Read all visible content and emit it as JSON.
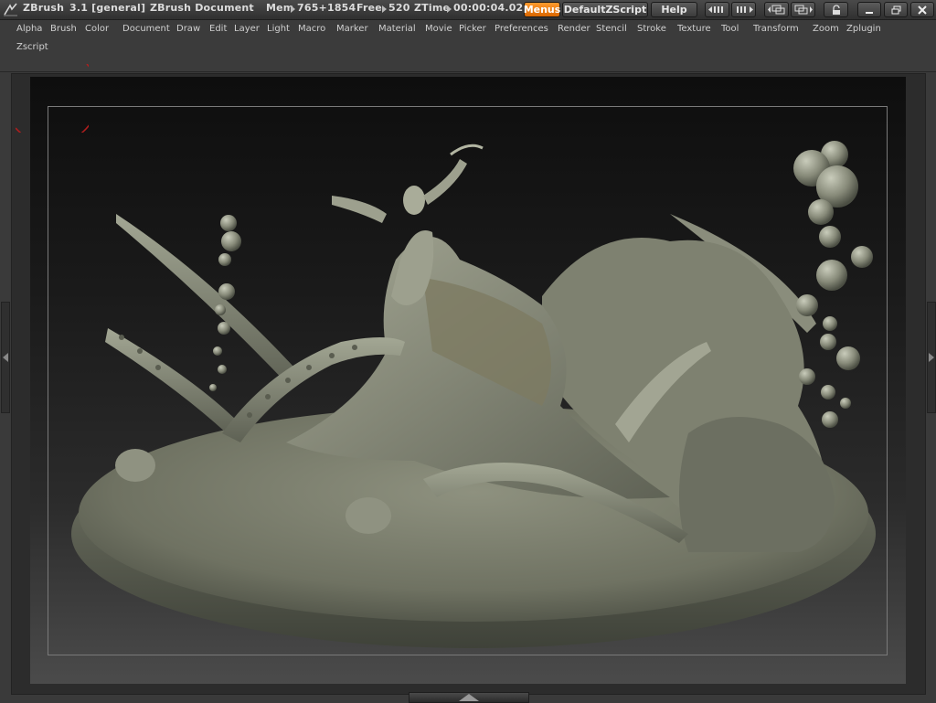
{
  "titlebar": {
    "app_name": "ZBrush",
    "version": "3.1 [general]",
    "document_name": "ZBrush Document",
    "mem_label": "Mem",
    "mem_value": "765+1854",
    "free_label": "Free",
    "free_value": "520",
    "ztime_label": "ZTime",
    "ztime_value": "00:00:04.02",
    "menus_button": "Menus",
    "script_button": "DefaultZScript",
    "help_button": "Help",
    "accent_color": "#f07a10"
  },
  "menubar": {
    "items": [
      "Alpha",
      "Brush",
      "Color",
      "Document",
      "Draw",
      "Edit",
      "Layer",
      "Light",
      "Macro",
      "Marker",
      "Material",
      "Movie",
      "Picker",
      "Preferences",
      "Render",
      "Stencil",
      "Stroke",
      "Texture",
      "Tool",
      "Transform",
      "Zoom",
      "Zplugin",
      "Zscript"
    ]
  },
  "icons": {
    "logo": "zbrush-logo-icon",
    "arrows": "arrow-right-icon",
    "window_controls": [
      "minimize-icon",
      "restore-icon",
      "close-icon"
    ]
  }
}
